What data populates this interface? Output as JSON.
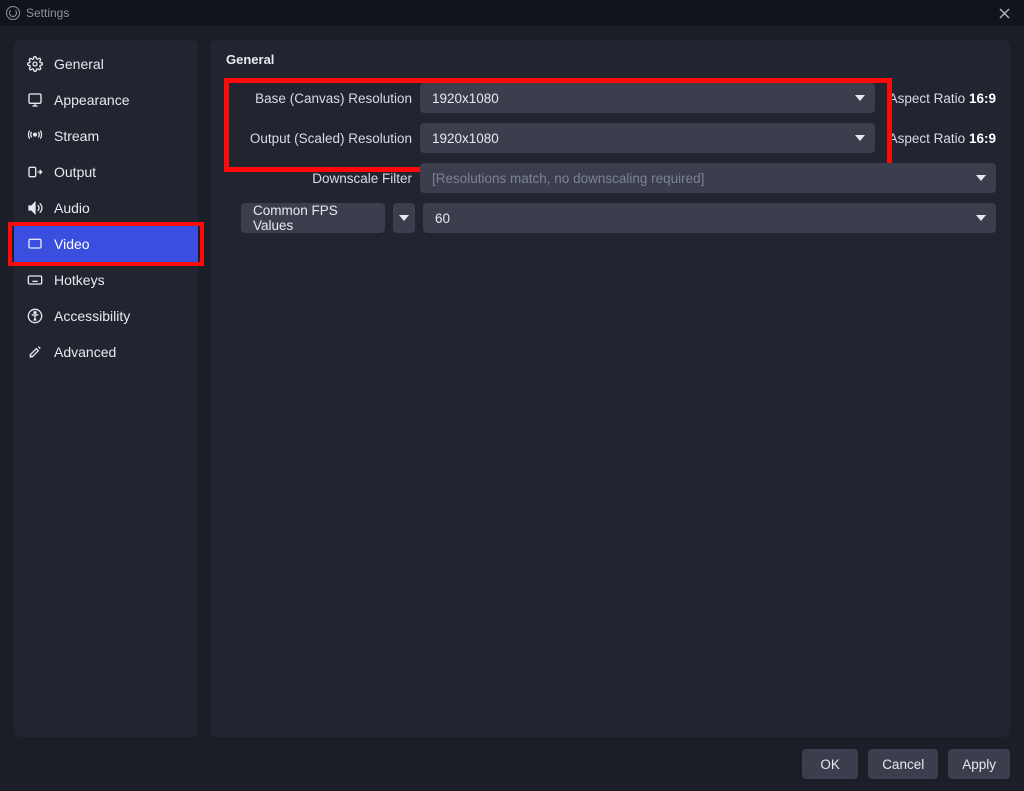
{
  "window": {
    "title": "Settings"
  },
  "sidebar": {
    "items": [
      {
        "id": "general",
        "label": "General"
      },
      {
        "id": "appearance",
        "label": "Appearance"
      },
      {
        "id": "stream",
        "label": "Stream"
      },
      {
        "id": "output",
        "label": "Output"
      },
      {
        "id": "audio",
        "label": "Audio"
      },
      {
        "id": "video",
        "label": "Video"
      },
      {
        "id": "hotkeys",
        "label": "Hotkeys"
      },
      {
        "id": "accessibility",
        "label": "Accessibility"
      },
      {
        "id": "advanced",
        "label": "Advanced"
      }
    ],
    "selected": "video"
  },
  "panel": {
    "section_title": "General",
    "base_resolution": {
      "label": "Base (Canvas) Resolution",
      "value": "1920x1080",
      "aspect_label": "Aspect Ratio",
      "aspect_value": "16:9"
    },
    "output_resolution": {
      "label": "Output (Scaled) Resolution",
      "value": "1920x1080",
      "aspect_label": "Aspect Ratio",
      "aspect_value": "16:9"
    },
    "downscale_filter": {
      "label": "Downscale Filter",
      "value": "[Resolutions match, no downscaling required]",
      "disabled": true
    },
    "fps": {
      "mode_label": "Common FPS Values",
      "value": "60"
    }
  },
  "footer": {
    "ok": "OK",
    "cancel": "Cancel",
    "apply": "Apply"
  }
}
